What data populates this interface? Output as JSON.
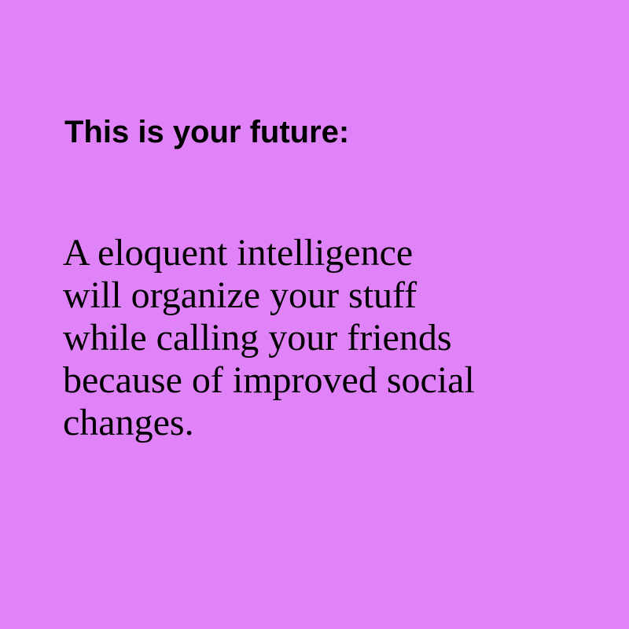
{
  "background_color": "#e083f8",
  "text_color": "#000000",
  "heading": "This is your future:",
  "body_lines": [
    "A eloquent intelligence",
    "will organize your stuff",
    "while calling your friends",
    "because of improved social",
    "changes."
  ]
}
